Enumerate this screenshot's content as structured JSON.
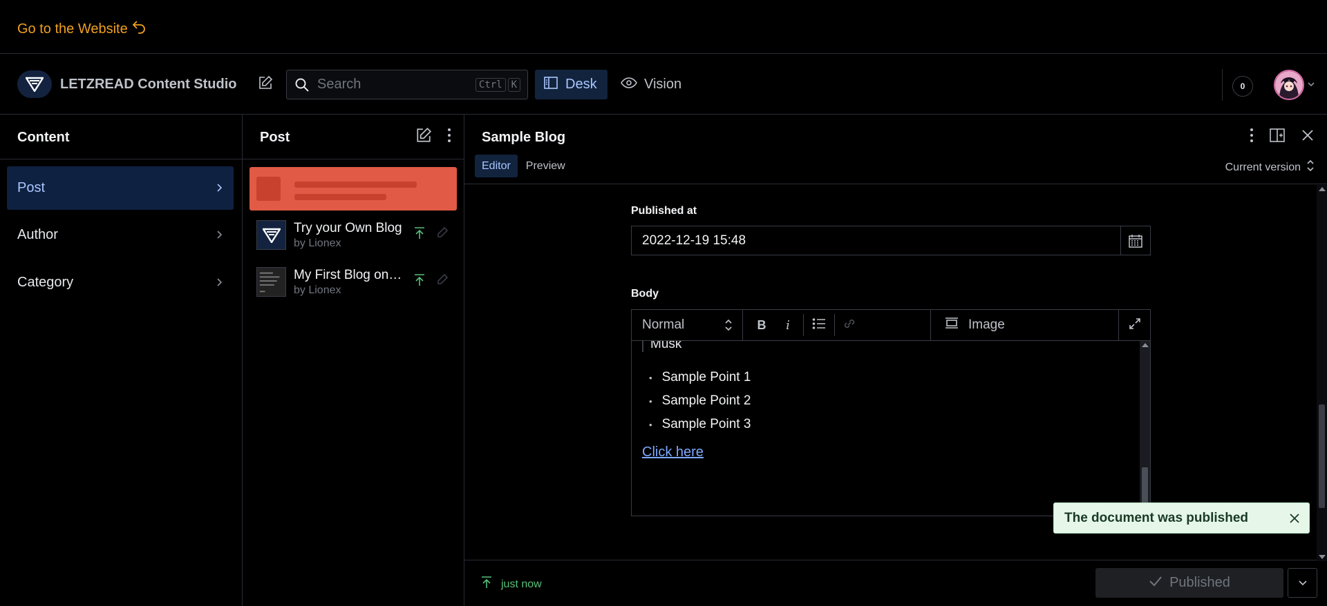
{
  "topbar": {
    "goto_label": "Go to the Website"
  },
  "navbar": {
    "brand_title": "LETZREAD Content Studio",
    "search": {
      "placeholder": "Search",
      "shortcut_keys": [
        "Ctrl",
        "K"
      ]
    },
    "tools": [
      {
        "label": "Desk",
        "icon": "desk-icon",
        "active": true
      },
      {
        "label": "Vision",
        "icon": "eye-icon",
        "active": false
      }
    ],
    "notification_count": "0"
  },
  "content_pane": {
    "title": "Content",
    "items": [
      {
        "label": "Post",
        "active": true
      },
      {
        "label": "Author",
        "active": false
      },
      {
        "label": "Category",
        "active": false
      }
    ]
  },
  "post_pane": {
    "title": "Post",
    "items": [
      {
        "title": "Try your Own Blog",
        "author": "by Lionex"
      },
      {
        "title": "My First Blog on Sanity",
        "author": "by Lionex"
      }
    ]
  },
  "document": {
    "title": "Sample Blog",
    "tabs": [
      {
        "label": "Editor",
        "active": true
      },
      {
        "label": "Preview",
        "active": false
      }
    ],
    "version_label": "Current version",
    "published_at": {
      "label": "Published at",
      "value": "2022-12-19 15:48"
    },
    "body": {
      "label": "Body",
      "style_value": "Normal",
      "bold_label": "B",
      "italic_label": "i",
      "image_label": "Image",
      "quote_text": "Musk",
      "bullets": [
        "Sample Point 1",
        "Sample Point 2",
        "Sample Point 3"
      ],
      "link_text": "Click here"
    },
    "toast": "The document was published",
    "status_text": "just now",
    "publish_label": "Published"
  },
  "colors": {
    "accent": "#f0a020",
    "active_bg": "#12233d",
    "toast_bg": "#e6f7ea",
    "placeholder": "#e05a45"
  }
}
